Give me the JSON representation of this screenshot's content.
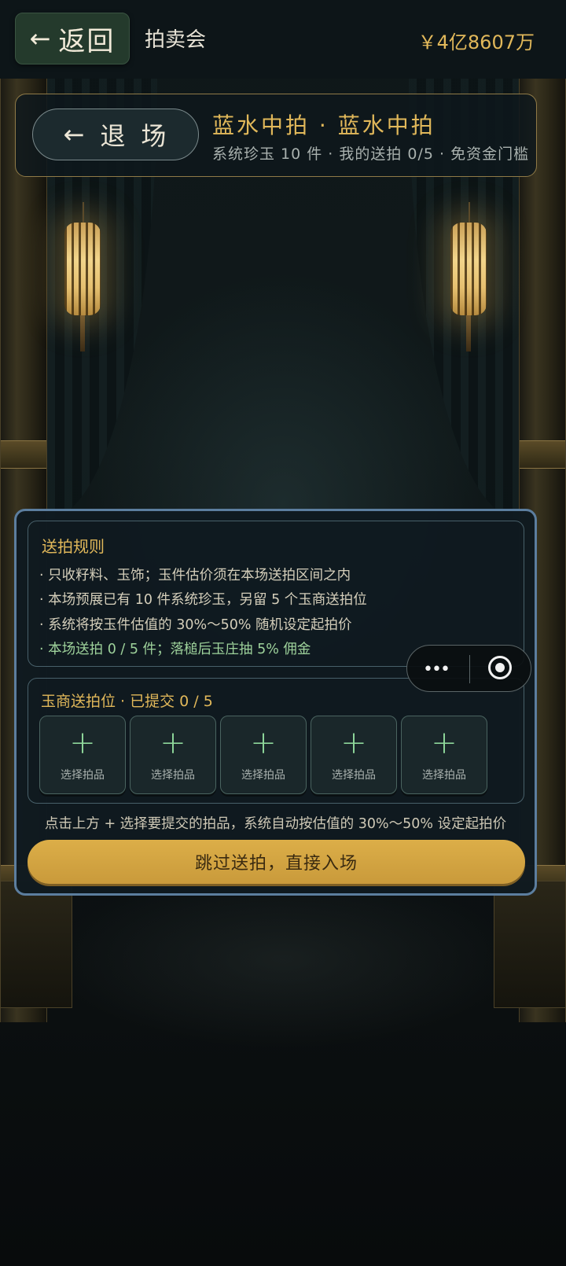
{
  "topbar": {
    "back_arrow": "←",
    "back_label": "返回",
    "title": "拍卖会",
    "funds": "￥4亿8607万"
  },
  "header": {
    "exit_arrow": "←",
    "exit_label": "退场",
    "hall_name": "蓝水中拍 · 蓝水中拍",
    "meta": "系统珍玉 10 件 · 我的送拍 0/5 · 免资金门槛"
  },
  "rules": {
    "title": "送拍规则",
    "items": [
      "· 只收籽料、玉饰；玉件估价须在本场送拍区间之内",
      "· 本场预展已有 10 件系统珍玉，另留 5 个玉商送拍位",
      "· 系统将按玉件估值的 30%～50% 随机设定起拍价",
      "· 本场送拍 0 / 5 件；落槌后玉庄抽 5% 佣金"
    ]
  },
  "slots": {
    "title": "玉商送拍位 · 已提交 0 / 5",
    "plus_symbol": "+",
    "items": [
      {
        "label": "选择拍品"
      },
      {
        "label": "选择拍品"
      },
      {
        "label": "选择拍品"
      },
      {
        "label": "选择拍品"
      },
      {
        "label": "选择拍品"
      }
    ]
  },
  "hint": "点击上方 + 选择要提交的拍品，系统自动按估值的 30%～50% 设定起拍价",
  "skip_button": "跳过送拍，直接入场",
  "capsule": {
    "more_icon": "•••",
    "close_icon": "target-icon"
  },
  "colors": {
    "accent_gold": "#e1b85a",
    "button_gold": "#d4a843",
    "green_text": "#9ed29b",
    "dialog_border": "#5c7e9f",
    "back_button_bg": "#243a2c"
  }
}
